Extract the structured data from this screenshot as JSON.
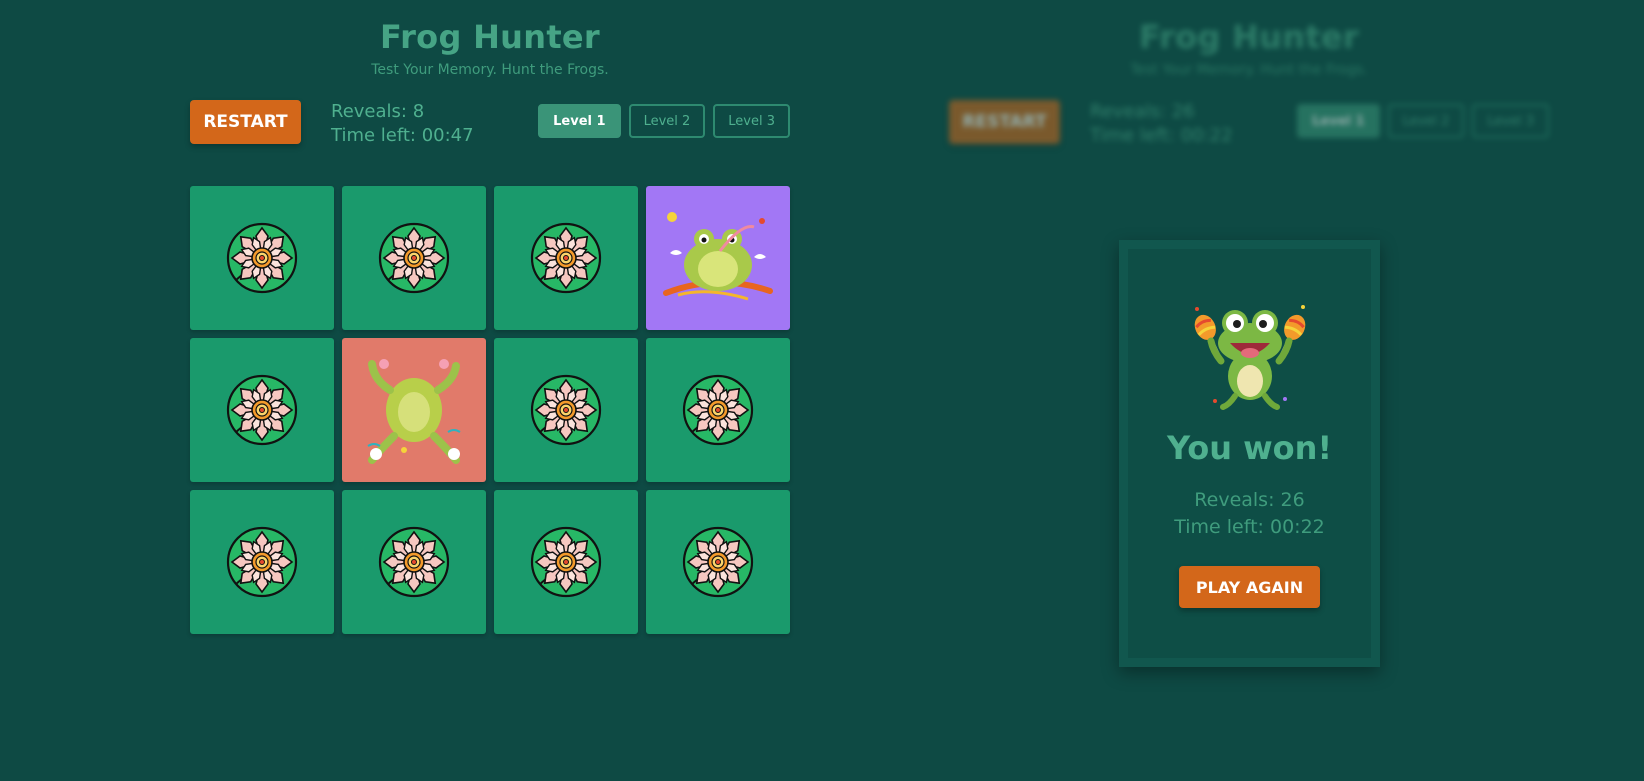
{
  "app": {
    "title": "Frog Hunter",
    "subtitle": "Test Your Memory. Hunt the Frogs."
  },
  "controls": {
    "restart_label": "RESTART",
    "reveals": "Reveals: 8",
    "time_left": "Time left: 00:47",
    "levels": [
      {
        "label": "Level 1",
        "active": true
      },
      {
        "label": "Level 2",
        "active": false
      },
      {
        "label": "Level 3",
        "active": false
      }
    ]
  },
  "board": {
    "columns": 4,
    "rows": 3,
    "cards": [
      {
        "state": "hidden",
        "icon": "lotus-icon"
      },
      {
        "state": "hidden",
        "icon": "lotus-icon"
      },
      {
        "state": "hidden",
        "icon": "lotus-icon"
      },
      {
        "state": "revealed",
        "icon": "frog-on-branch-icon",
        "color": "#a277f5"
      },
      {
        "state": "hidden",
        "icon": "lotus-icon"
      },
      {
        "state": "revealed",
        "icon": "frog-jumping-icon",
        "color": "#e17a6a"
      },
      {
        "state": "hidden",
        "icon": "lotus-icon"
      },
      {
        "state": "hidden",
        "icon": "lotus-icon"
      },
      {
        "state": "hidden",
        "icon": "lotus-icon"
      },
      {
        "state": "hidden",
        "icon": "lotus-icon"
      },
      {
        "state": "hidden",
        "icon": "lotus-icon"
      },
      {
        "state": "hidden",
        "icon": "lotus-icon"
      }
    ]
  },
  "background_game": {
    "title": "Frog Hunter",
    "subtitle": "Test Your Memory. Hunt the Frogs.",
    "restart_label": "RESTART",
    "reveals": "Reveals: 26",
    "time_left": "Time left: 00:22",
    "levels": [
      "Level 1",
      "Level 2",
      "Level 3"
    ]
  },
  "modal": {
    "heading": "You won!",
    "reveals": "Reveals: 26",
    "time_left": "Time left: 00:22",
    "play_again_label": "PLAY AGAIN",
    "icon": "frog-maracas-icon"
  },
  "colors": {
    "background": "#0e4a44",
    "card": "#1a9a6c",
    "accent_orange": "#d3671a",
    "text_green": "#4fb08f"
  }
}
